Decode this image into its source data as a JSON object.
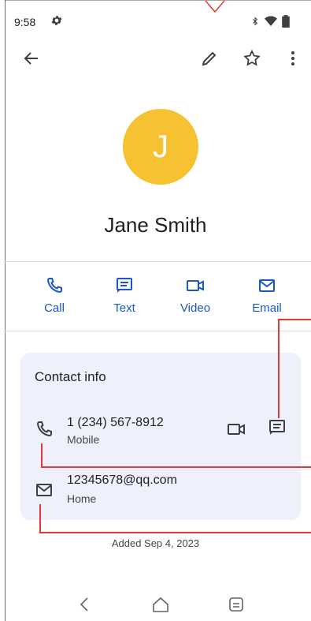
{
  "status_bar": {
    "time": "9:58",
    "icons": [
      "gear-icon",
      "bluetooth-icon",
      "wifi-icon",
      "battery-icon"
    ]
  },
  "toolbar": {
    "back_icon": "arrow-left-icon",
    "edit_icon": "pencil-icon",
    "star_icon": "star-outline-icon",
    "more_icon": "more-vertical-icon"
  },
  "contact": {
    "initial": "J",
    "name": "Jane Smith"
  },
  "actions": [
    {
      "label": "Call",
      "icon": "phone-icon"
    },
    {
      "label": "Text",
      "icon": "message-icon"
    },
    {
      "label": "Video",
      "icon": "video-icon"
    },
    {
      "label": "Email",
      "icon": "mail-icon"
    }
  ],
  "contact_info": {
    "title": "Contact info",
    "phone": {
      "value": "1 (234) 567-8912",
      "type": "Mobile"
    },
    "email": {
      "value": "12345678@qq.com",
      "type": "Home"
    }
  },
  "footer_note": "Added Sep 4, 2023",
  "nav": {
    "back_icon": "nav-back-icon",
    "home_icon": "nav-home-icon",
    "recents_icon": "nav-recents-icon"
  },
  "colors": {
    "accent": "#1a57c7",
    "avatar": "#f6c232",
    "card_bg": "#eef1fb",
    "annotation": "#e53935"
  }
}
